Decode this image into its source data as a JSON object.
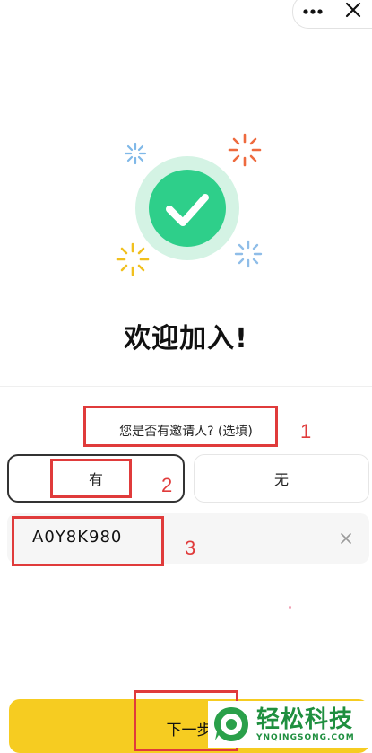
{
  "topbar": {
    "more_icon": "more-dots-icon",
    "close_icon": "close-icon"
  },
  "hero": {
    "badge_icon": "checkmark-icon",
    "badge_color": "#2ecf8a",
    "ring_color": "#d4f3e4",
    "sparkle_colors": [
      "#7fb8e8",
      "#ee6a3e",
      "#f1c01e",
      "#8fbde8"
    ]
  },
  "welcome": {
    "title": "欢迎加入!"
  },
  "invite": {
    "question": "您是否有邀请人? (选填)",
    "option_yes": "有",
    "option_no": "无",
    "selected": "有"
  },
  "code_field": {
    "value": "A0Y8K980",
    "clear_icon": "clear-x-icon"
  },
  "next_button": {
    "label": "下一步",
    "color": "#f6cc21"
  },
  "annotations": {
    "color": "#e03b3b",
    "labels": [
      "1",
      "2",
      "3"
    ]
  },
  "watermark": {
    "text_cn": "轻松科技",
    "text_en": "YNQINGSONG.COM",
    "color": "#1f8f3f"
  }
}
